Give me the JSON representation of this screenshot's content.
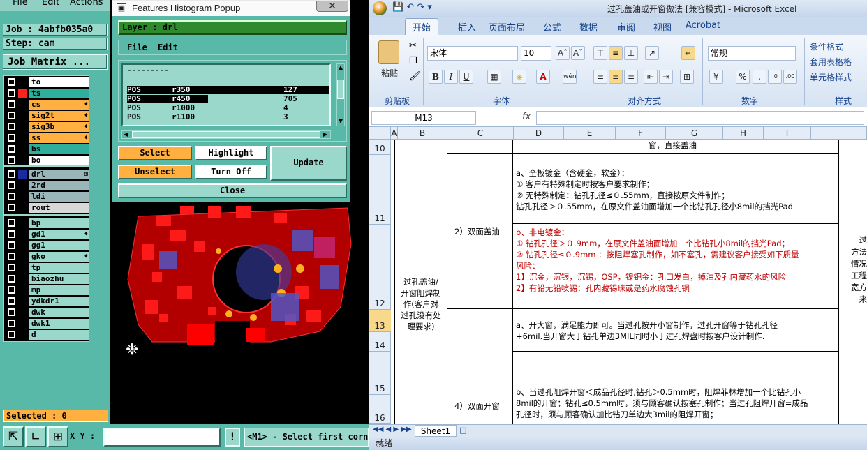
{
  "cam": {
    "menu": [
      "File",
      "Edit",
      "Actions"
    ],
    "job_label": "Job : 4abfb035a0",
    "step_label": "Step: cam",
    "job_matrix": "Job Matrix ...",
    "layers_top": [
      {
        "name": "to",
        "color": "#ffffff",
        "chip": "#000000",
        "marker": ""
      },
      {
        "name": "ts",
        "color": "#2fae9c",
        "chip": "#ff2020",
        "marker": ""
      },
      {
        "name": "cs",
        "color": "#ffb040",
        "chip": "#000000",
        "marker": "♦"
      },
      {
        "name": "sig2t",
        "color": "#ffb040",
        "chip": "#000000",
        "marker": "♦"
      },
      {
        "name": "sig3b",
        "color": "#ffb040",
        "chip": "#000000",
        "marker": "♦"
      },
      {
        "name": "ss",
        "color": "#ffb040",
        "chip": "#000000",
        "marker": "♦"
      },
      {
        "name": "bs",
        "color": "#2fae9c",
        "chip": "#000000",
        "marker": ""
      },
      {
        "name": "bo",
        "color": "#ffffff",
        "chip": "#000000",
        "marker": ""
      }
    ],
    "layers_mid": [
      {
        "name": "drl",
        "color": "#9ab6b8",
        "chip": "#1a2aa0",
        "marker": "⊞"
      },
      {
        "name": "2rd",
        "color": "#9ab6b8",
        "chip": "#000000",
        "marker": ""
      },
      {
        "name": "ldi",
        "color": "#9ab6b8",
        "chip": "#000000",
        "marker": ""
      },
      {
        "name": "rout",
        "color": "#d8d8d8",
        "chip": "#000000",
        "marker": ""
      }
    ],
    "layers_bottom": [
      {
        "name": "bp",
        "color": "#9ad8cc",
        "chip": "#000000",
        "marker": ""
      },
      {
        "name": "gd1",
        "color": "#9ad8cc",
        "chip": "#000000",
        "marker": "♦"
      },
      {
        "name": "gg1",
        "color": "#9ad8cc",
        "chip": "#000000",
        "marker": ""
      },
      {
        "name": "gko",
        "color": "#9ad8cc",
        "chip": "#000000",
        "marker": "♦"
      },
      {
        "name": "tp",
        "color": "#9ad8cc",
        "chip": "#000000",
        "marker": ""
      },
      {
        "name": "biaozhu",
        "color": "#9ad8cc",
        "chip": "#000000",
        "marker": ""
      },
      {
        "name": "mp",
        "color": "#9ad8cc",
        "chip": "#000000",
        "marker": ""
      },
      {
        "name": "ydkdr1",
        "color": "#9ad8cc",
        "chip": "#000000",
        "marker": ""
      },
      {
        "name": "dwk",
        "color": "#9ad8cc",
        "chip": "#000000",
        "marker": ""
      },
      {
        "name": "dwk1",
        "color": "#9ad8cc",
        "chip": "#000000",
        "marker": ""
      },
      {
        "name": "d",
        "color": "#9ad8cc",
        "chip": "#000000",
        "marker": ""
      }
    ],
    "selected": "Selected : 0",
    "xy_label": "X Y :",
    "status_bang": "!",
    "status_msg": "<M1> - Select first corne"
  },
  "popup": {
    "title": "Features Histogram Popup",
    "layer": "Layer :  drl",
    "menu": [
      "File",
      "Edit"
    ],
    "list_header": "---------",
    "rows": [
      {
        "type": "POS",
        "sym": "r350",
        "count": "127",
        "selected": true
      },
      {
        "type": "POS",
        "sym": "r450",
        "count": "705",
        "selected": false,
        "partial": true
      },
      {
        "type": "POS",
        "sym": "r1000",
        "count": "4",
        "selected": false
      },
      {
        "type": "POS",
        "sym": "r1100",
        "count": "3",
        "selected": false
      }
    ],
    "buttons": {
      "select": "Select",
      "highlight": "Highlight",
      "update": "Update",
      "unselect": "Unselect",
      "turn_off": "Turn Off",
      "close": "Close"
    }
  },
  "excel": {
    "title": "过孔盖油或开窗做法  [兼容模式] - Microsoft Excel",
    "tabs": [
      "开始",
      "插入",
      "页面布局",
      "公式",
      "数据",
      "审阅",
      "视图",
      "Acrobat"
    ],
    "groups": [
      "剪贴板",
      "字体",
      "对齐方式",
      "数字",
      "样式"
    ],
    "paste": "粘贴",
    "font_name": "宋体",
    "font_size": "10",
    "number_format": "常规",
    "styles": [
      "条件格式",
      "套用表格格",
      "单元格样式"
    ],
    "name_box": "M13",
    "fx": "fx",
    "columns": [
      "A",
      "B",
      "C",
      "D",
      "E",
      "F",
      "G",
      "H",
      "I"
    ],
    "rows": [
      "10",
      "11",
      "12",
      "13",
      "14",
      "15",
      "16"
    ],
    "cells": {
      "r10_text": "窗，直接盖油",
      "b_merge": [
        "过孔盖油/",
        "开窗阻焊制",
        "作(客户对",
        "过孔没有处",
        "理要求)"
      ],
      "c_double_oil": "2）双面盖油",
      "c_double_open": "4）双面开窗",
      "r11": [
        "a、全板镀金（含硬金，软金）：",
        "① 客户有特殊制定时按客户要求制作；",
        "② 无特殊制定：钻孔孔径≤０.55mm，直接按原文件制作；",
        "    钻孔孔径＞０.55mm，在原文件盖油面增加一个比钻孔孔径小8mil的挡光Pad"
      ],
      "r12": [
        "b、非电镀金：",
        "① 钻孔孔径＞０.9mm，在原文件盖油面增加一个比钻孔小8mil的挡光Pad；",
        "② 钻孔孔径≤０.9mm ：按阻焊塞孔制作，如不塞孔，需建议客户接受如下质量",
        "风险：",
        "1】沉金，沉银，沉锡，OSP，镍钯金：孔口发白，掉油及孔内藏药水的风险",
        "2】有铅无铅喷锡：孔内藏锡珠或是药水腐蚀孔铜"
      ],
      "r13": [
        "a、开大窗，满足能力即可。当过孔按开小窗制作，过孔开窗等于钻孔孔径",
        "+6mil.当开窗大于钻孔单边3MIL同时小于过孔焊盘时按客户设计制作."
      ],
      "r16": [
        "b、当过孔阻焊开窗＜成品孔径时,钻孔＞0.5mm时，阻焊菲林增加一个比钻孔小",
        "8mil的开窗；钻孔≤0.5mm时，须与顾客确认按塞孔制作；当过孔阻焊开窗=成品",
        "孔径时，须与顾客确认加比钻刀单边大3mil的阻焊开窗；"
      ],
      "i_col": [
        "过",
        "方法",
        "情况",
        "工程",
        "宽方",
        "来"
      ]
    },
    "sheet_tab": "Sheet1",
    "status": "就绪"
  }
}
